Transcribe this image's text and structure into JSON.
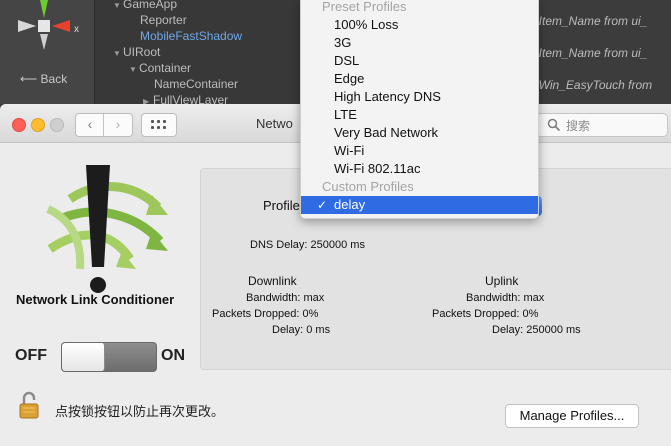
{
  "editor": {
    "back_label": "Back",
    "axis_label": "x",
    "hierarchy": [
      {
        "label": "GameApp",
        "expanded": true
      },
      {
        "label": "Reporter"
      },
      {
        "label": "MobileFastShadow",
        "selected": true
      },
      {
        "label": "UIRoot",
        "expanded": true
      },
      {
        "label": "Container",
        "expanded": true
      },
      {
        "label": "NameContainer"
      },
      {
        "label": "FullViewLayer",
        "expanded": false
      }
    ],
    "code_lines": [
      "UI_Item_Name from ui_",
      "UI_Item_Name from ui_",
      "UI_Win_EasyTouch from"
    ]
  },
  "window": {
    "title": "Network Link Conditioner",
    "title_visible": "Netwo",
    "search_placeholder": "搜索",
    "app_name": "Network Link Conditioner",
    "toggle": {
      "off_label": "OFF",
      "on_label": "ON",
      "state": "off"
    },
    "profile_label": "Profile",
    "dns_delay": "DNS Delay: 250000 ms",
    "downlink": {
      "header": "Downlink",
      "bandwidth": "Bandwidth: max",
      "packets_dropped": "Packets Dropped: 0%",
      "delay": "Delay: 0 ms"
    },
    "uplink": {
      "header": "Uplink",
      "bandwidth": "Bandwidth: max",
      "packets_dropped": "Packets Dropped: 0%",
      "delay": "Delay: 250000 ms"
    },
    "lock_text": "点按锁按钮以防止再次更改。",
    "manage_button": "Manage Profiles..."
  },
  "menu": {
    "preset_header": "Preset Profiles",
    "presets": [
      "100% Loss",
      "3G",
      "DSL",
      "Edge",
      "High Latency DNS",
      "LTE",
      "Very Bad Network",
      "Wi-Fi",
      "Wi-Fi 802.11ac"
    ],
    "custom_header": "Custom Profiles",
    "custom": [
      "delay"
    ],
    "selected": "delay",
    "check_glyph": "✓"
  },
  "colors": {
    "selection": "#2f6be3",
    "editor_bg": "#3c3c3c",
    "window_bg": "#ececec"
  }
}
